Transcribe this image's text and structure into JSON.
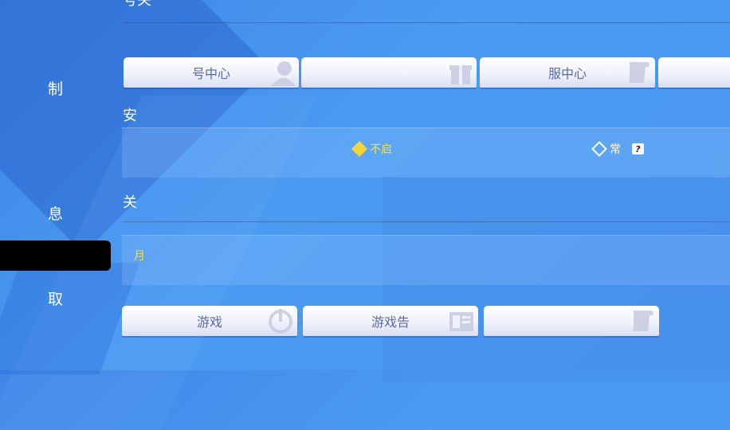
{
  "sidebar": {
    "items": [
      {
        "label": "制"
      },
      {
        "label": "息"
      },
      {
        "label": ""
      },
      {
        "label": "取"
      }
    ]
  },
  "account": {
    "top_title": "号关",
    "buttons": [
      {
        "label": "号中心",
        "icon": "user-icon"
      },
      {
        "label": "",
        "icon": "gift-box-icon"
      },
      {
        "label": "服中心",
        "icon": "service-scroll-icon"
      },
      {
        "label": "",
        "icon": ""
      }
    ]
  },
  "security": {
    "title": "安",
    "options": [
      {
        "label": "不启",
        "checked": true
      },
      {
        "label": "常",
        "checked": false,
        "help": "?"
      }
    ]
  },
  "about": {
    "title": "关",
    "field_text": "月",
    "buttons": [
      {
        "label": "游戏",
        "icon": "power-icon"
      },
      {
        "label": "游戏告",
        "icon": "notice-board-icon"
      },
      {
        "label": "",
        "icon": "service-scroll-icon"
      }
    ]
  },
  "colors": {
    "accent_yellow": "#f5e14a",
    "button_text": "#5a68a8",
    "background_blue": "#4a96ee"
  }
}
